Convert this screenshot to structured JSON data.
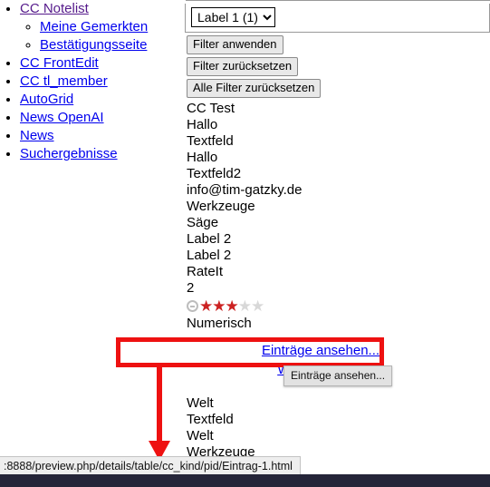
{
  "sidebar": {
    "items": [
      {
        "label": "CC Notelist",
        "state": "visited",
        "children": [
          {
            "label": "Meine Gemerkten",
            "state": "unvisited"
          },
          {
            "label": "Bestätigungsseite",
            "state": "unvisited"
          }
        ]
      },
      {
        "label": "CC FrontEdit",
        "state": "unvisited"
      },
      {
        "label": "CC tl_member",
        "state": "unvisited"
      },
      {
        "label": "AutoGrid",
        "state": "unvisited"
      },
      {
        "label": "News OpenAI",
        "state": "unvisited"
      },
      {
        "label": "News",
        "state": "unvisited"
      },
      {
        "label": "Suchergebnisse",
        "state": "unvisited"
      }
    ]
  },
  "filter_panel": {
    "select": {
      "selected": "Label 1 (1)",
      "options": [
        "Label 1 (1)"
      ]
    },
    "buttons": [
      {
        "label": "Filter anwenden"
      },
      {
        "label": "Filter zurücksetzen"
      },
      {
        "label": "Alle Filter zurücksetzen"
      }
    ]
  },
  "record_fields": [
    "CC Test",
    "Hallo",
    "Textfeld",
    "Hallo",
    "Textfeld2",
    "info@tim-gatzky.de",
    "Werkzeuge",
    "Säge",
    "Label 2",
    "Label 2",
    "RateIt",
    "2"
  ],
  "rating": {
    "value": 3,
    "max": 5,
    "star_glyph": "★",
    "filled_color": "#cc2222",
    "empty_color": "#d8d8d8",
    "clear_icon": "clear-rating-icon"
  },
  "record_fields_after_rating": [
    "Numerisch"
  ],
  "links": {
    "entries": "Einträge ansehen...",
    "readmore": "Weiterlesen ..."
  },
  "tail_fields": [
    "Welt",
    "Textfeld",
    "Welt",
    "Werkzeuge"
  ],
  "tooltip": {
    "text": "Einträge ansehen..."
  },
  "statusbar": {
    "url": ":8888/preview.php/details/table/cc_kind/pid/Eintrag-1.html"
  },
  "annotation": {
    "color": "#ee1111",
    "shape": "box-with-down-arrow",
    "target": "Einträge ansehen..."
  }
}
